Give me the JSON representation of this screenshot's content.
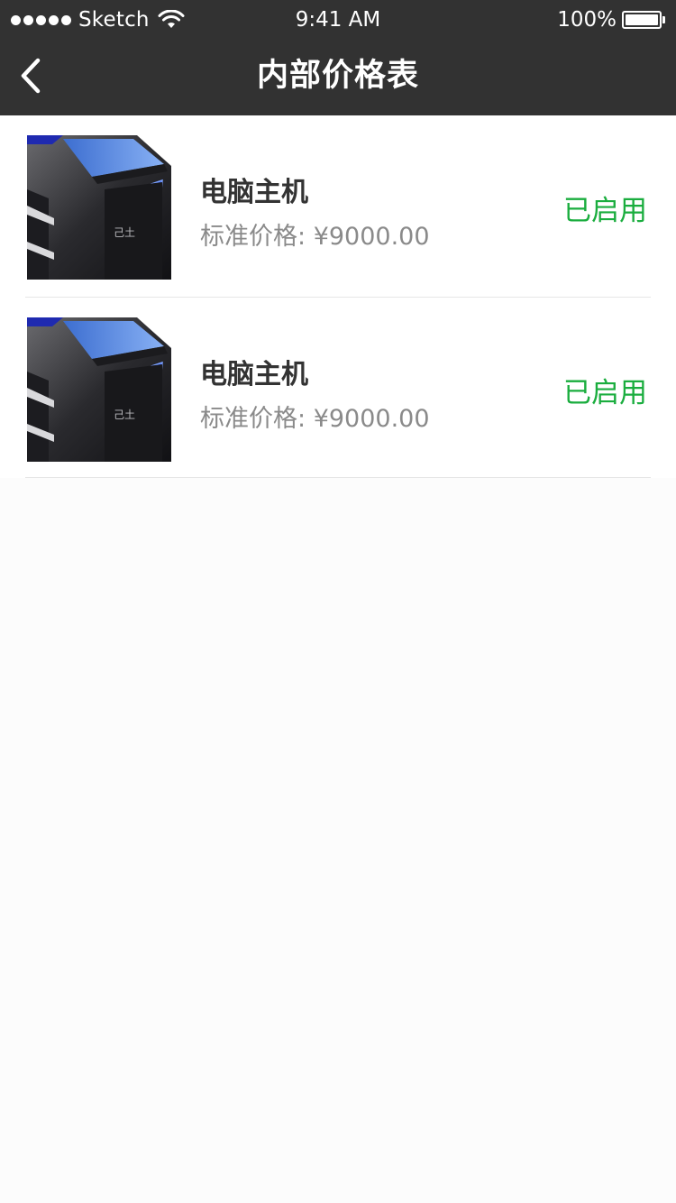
{
  "status_bar": {
    "carrier": "Sketch",
    "time": "9:41 AM",
    "battery_percent": "100%",
    "battery_level": 1.0
  },
  "nav": {
    "title": "内部价格表",
    "back_icon": "chevron-left-icon"
  },
  "products": [
    {
      "name": "电脑主机",
      "price_label": "标准价格:",
      "price": "¥9000.00",
      "status": "已启用"
    },
    {
      "name": "电脑主机",
      "price_label": "标准价格:",
      "price": "¥9000.00",
      "status": "已启用"
    }
  ],
  "colors": {
    "header_bg": "#323232",
    "status_enabled": "#1aad3e",
    "page_bg": "#fcfcfc"
  }
}
